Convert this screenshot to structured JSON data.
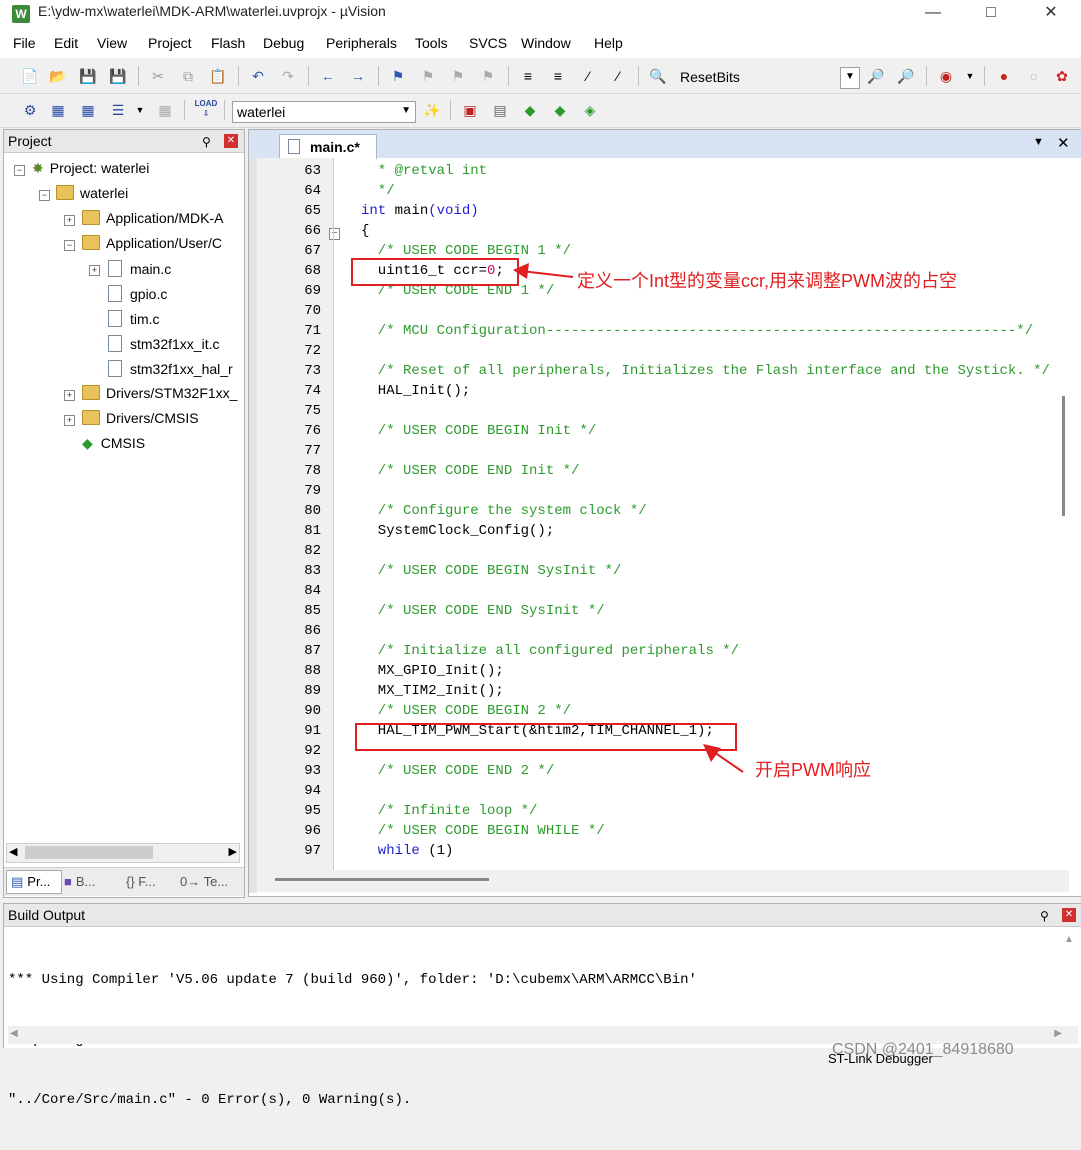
{
  "window": {
    "title": "E:\\ydw-mx\\waterlei\\MDK-ARM\\waterlei.uvprojx - µVision",
    "app_icon": "W"
  },
  "menu": [
    "File",
    "Edit",
    "View",
    "Project",
    "Flash",
    "Debug",
    "Peripherals",
    "Tools",
    "SVCS",
    "Window",
    "Help"
  ],
  "toolbar": {
    "resetbits_label": "ResetBits",
    "target_value": "waterlei",
    "load_label": "LOAD"
  },
  "project": {
    "title": "Project",
    "tree": [
      "Project: waterlei",
      "waterlei",
      "Application/MDK-A",
      "Application/User/C",
      "main.c",
      "gpio.c",
      "tim.c",
      "stm32f1xx_it.c",
      "stm32f1xx_hal_r",
      "Drivers/STM32F1xx_",
      "Drivers/CMSIS",
      "CMSIS"
    ],
    "tabs": [
      "Pr...",
      "B...",
      "{} F...",
      "0→ Te..."
    ]
  },
  "editor": {
    "tab_label": "main.c*",
    "lines": [
      {
        "n": "63",
        "t": "  * @retval int",
        "c": "cm"
      },
      {
        "n": "64",
        "t": "  */",
        "c": "cm"
      },
      {
        "n": "65",
        "t": "int main(void)",
        "c": "main"
      },
      {
        "n": "66",
        "t": "{",
        "c": ""
      },
      {
        "n": "67",
        "t": "  /* USER CODE BEGIN 1 */",
        "c": "cm"
      },
      {
        "n": "68",
        "t": "  uint16_t ccr=0;",
        "c": "ccr"
      },
      {
        "n": "69",
        "t": "  /* USER CODE END 1 */",
        "c": "cm"
      },
      {
        "n": "70",
        "t": "",
        "c": ""
      },
      {
        "n": "71",
        "t": "  /* MCU Configuration--------------------------------------------------------*/",
        "c": "cm"
      },
      {
        "n": "72",
        "t": "",
        "c": ""
      },
      {
        "n": "73",
        "t": "  /* Reset of all peripherals, Initializes the Flash interface and the Systick. */",
        "c": "cm"
      },
      {
        "n": "74",
        "t": "  HAL_Init();",
        "c": ""
      },
      {
        "n": "75",
        "t": "",
        "c": ""
      },
      {
        "n": "76",
        "t": "  /* USER CODE BEGIN Init */",
        "c": "cm"
      },
      {
        "n": "77",
        "t": "",
        "c": ""
      },
      {
        "n": "78",
        "t": "  /* USER CODE END Init */",
        "c": "cm"
      },
      {
        "n": "79",
        "t": "",
        "c": ""
      },
      {
        "n": "80",
        "t": "  /* Configure the system clock */",
        "c": "cm"
      },
      {
        "n": "81",
        "t": "  SystemClock_Config();",
        "c": ""
      },
      {
        "n": "82",
        "t": "",
        "c": ""
      },
      {
        "n": "83",
        "t": "  /* USER CODE BEGIN SysInit */",
        "c": "cm"
      },
      {
        "n": "84",
        "t": "",
        "c": ""
      },
      {
        "n": "85",
        "t": "  /* USER CODE END SysInit */",
        "c": "cm"
      },
      {
        "n": "86",
        "t": "",
        "c": ""
      },
      {
        "n": "87",
        "t": "  /* Initialize all configured peripherals */",
        "c": "cm"
      },
      {
        "n": "88",
        "t": "  MX_GPIO_Init();",
        "c": ""
      },
      {
        "n": "89",
        "t": "  MX_TIM2_Init();",
        "c": ""
      },
      {
        "n": "90",
        "t": "  /* USER CODE BEGIN 2 */",
        "c": "cm"
      },
      {
        "n": "91",
        "t": "  HAL_TIM_PWM_Start(&htim2,TIM_CHANNEL_1);",
        "c": ""
      },
      {
        "n": "92",
        "t": "",
        "c": ""
      },
      {
        "n": "93",
        "t": "  /* USER CODE END 2 */",
        "c": "cm"
      },
      {
        "n": "94",
        "t": "",
        "c": ""
      },
      {
        "n": "95",
        "t": "  /* Infinite loop */",
        "c": "cm"
      },
      {
        "n": "96",
        "t": "  /* USER CODE BEGIN WHILE */",
        "c": "cm"
      },
      {
        "n": "97",
        "t": "  while (1)",
        "c": "while"
      }
    ],
    "annotations": [
      "定义一个Int型的变量ccr,用来调整PWM波的占空",
      "开启PWM响应"
    ]
  },
  "build_output": {
    "title": "Build Output",
    "lines": [
      "*** Using Compiler 'V5.06 update 7 (build 960)', folder: 'D:\\cubemx\\ARM\\ARMCC\\Bin'",
      "compiling main.c...",
      "\"../Core/Src/main.c\" - 0 Error(s), 0 Warning(s)."
    ]
  },
  "status": {
    "debugger": "ST-Link Debugger",
    "watermark": "CSDN @2401_84918680"
  }
}
